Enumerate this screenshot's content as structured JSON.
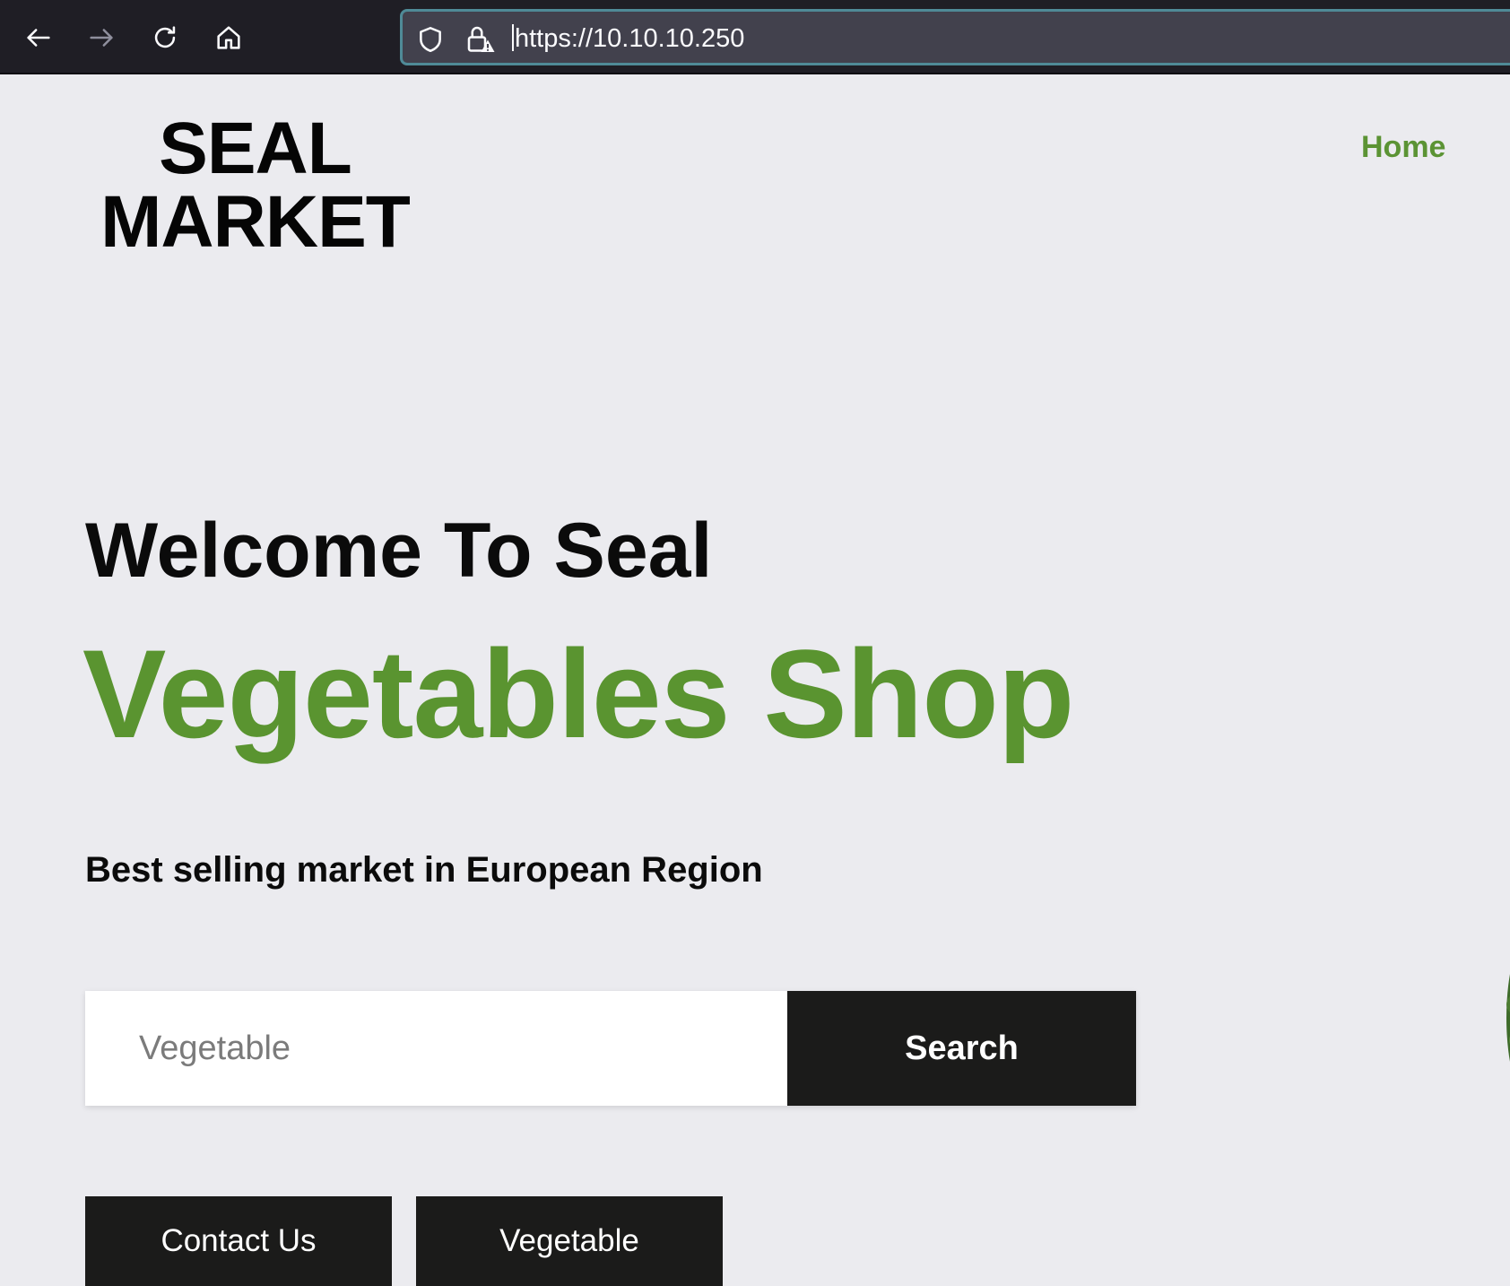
{
  "browser": {
    "url": "https://10.10.10.250",
    "icons": [
      "back-arrow-icon",
      "forward-arrow-icon",
      "reload-icon",
      "home-icon",
      "shield-icon",
      "lock-warning-icon"
    ]
  },
  "header": {
    "logo_line1": "SEAL",
    "logo_line2": "MARKET",
    "nav_home": "Home"
  },
  "hero": {
    "welcome": "Welcome To Seal",
    "title": "Vegetables Shop",
    "tagline": "Best selling market in European Region"
  },
  "search": {
    "placeholder": "Vegetable",
    "button_label": "Search"
  },
  "actions": {
    "contact_label": "Contact Us",
    "vegetable_label": "Vegetable"
  },
  "colors": {
    "accent_green": "#5a9430",
    "dark_button": "#1b1b1a",
    "page_background": "#ebebef",
    "browser_chrome": "#1f1e25"
  }
}
